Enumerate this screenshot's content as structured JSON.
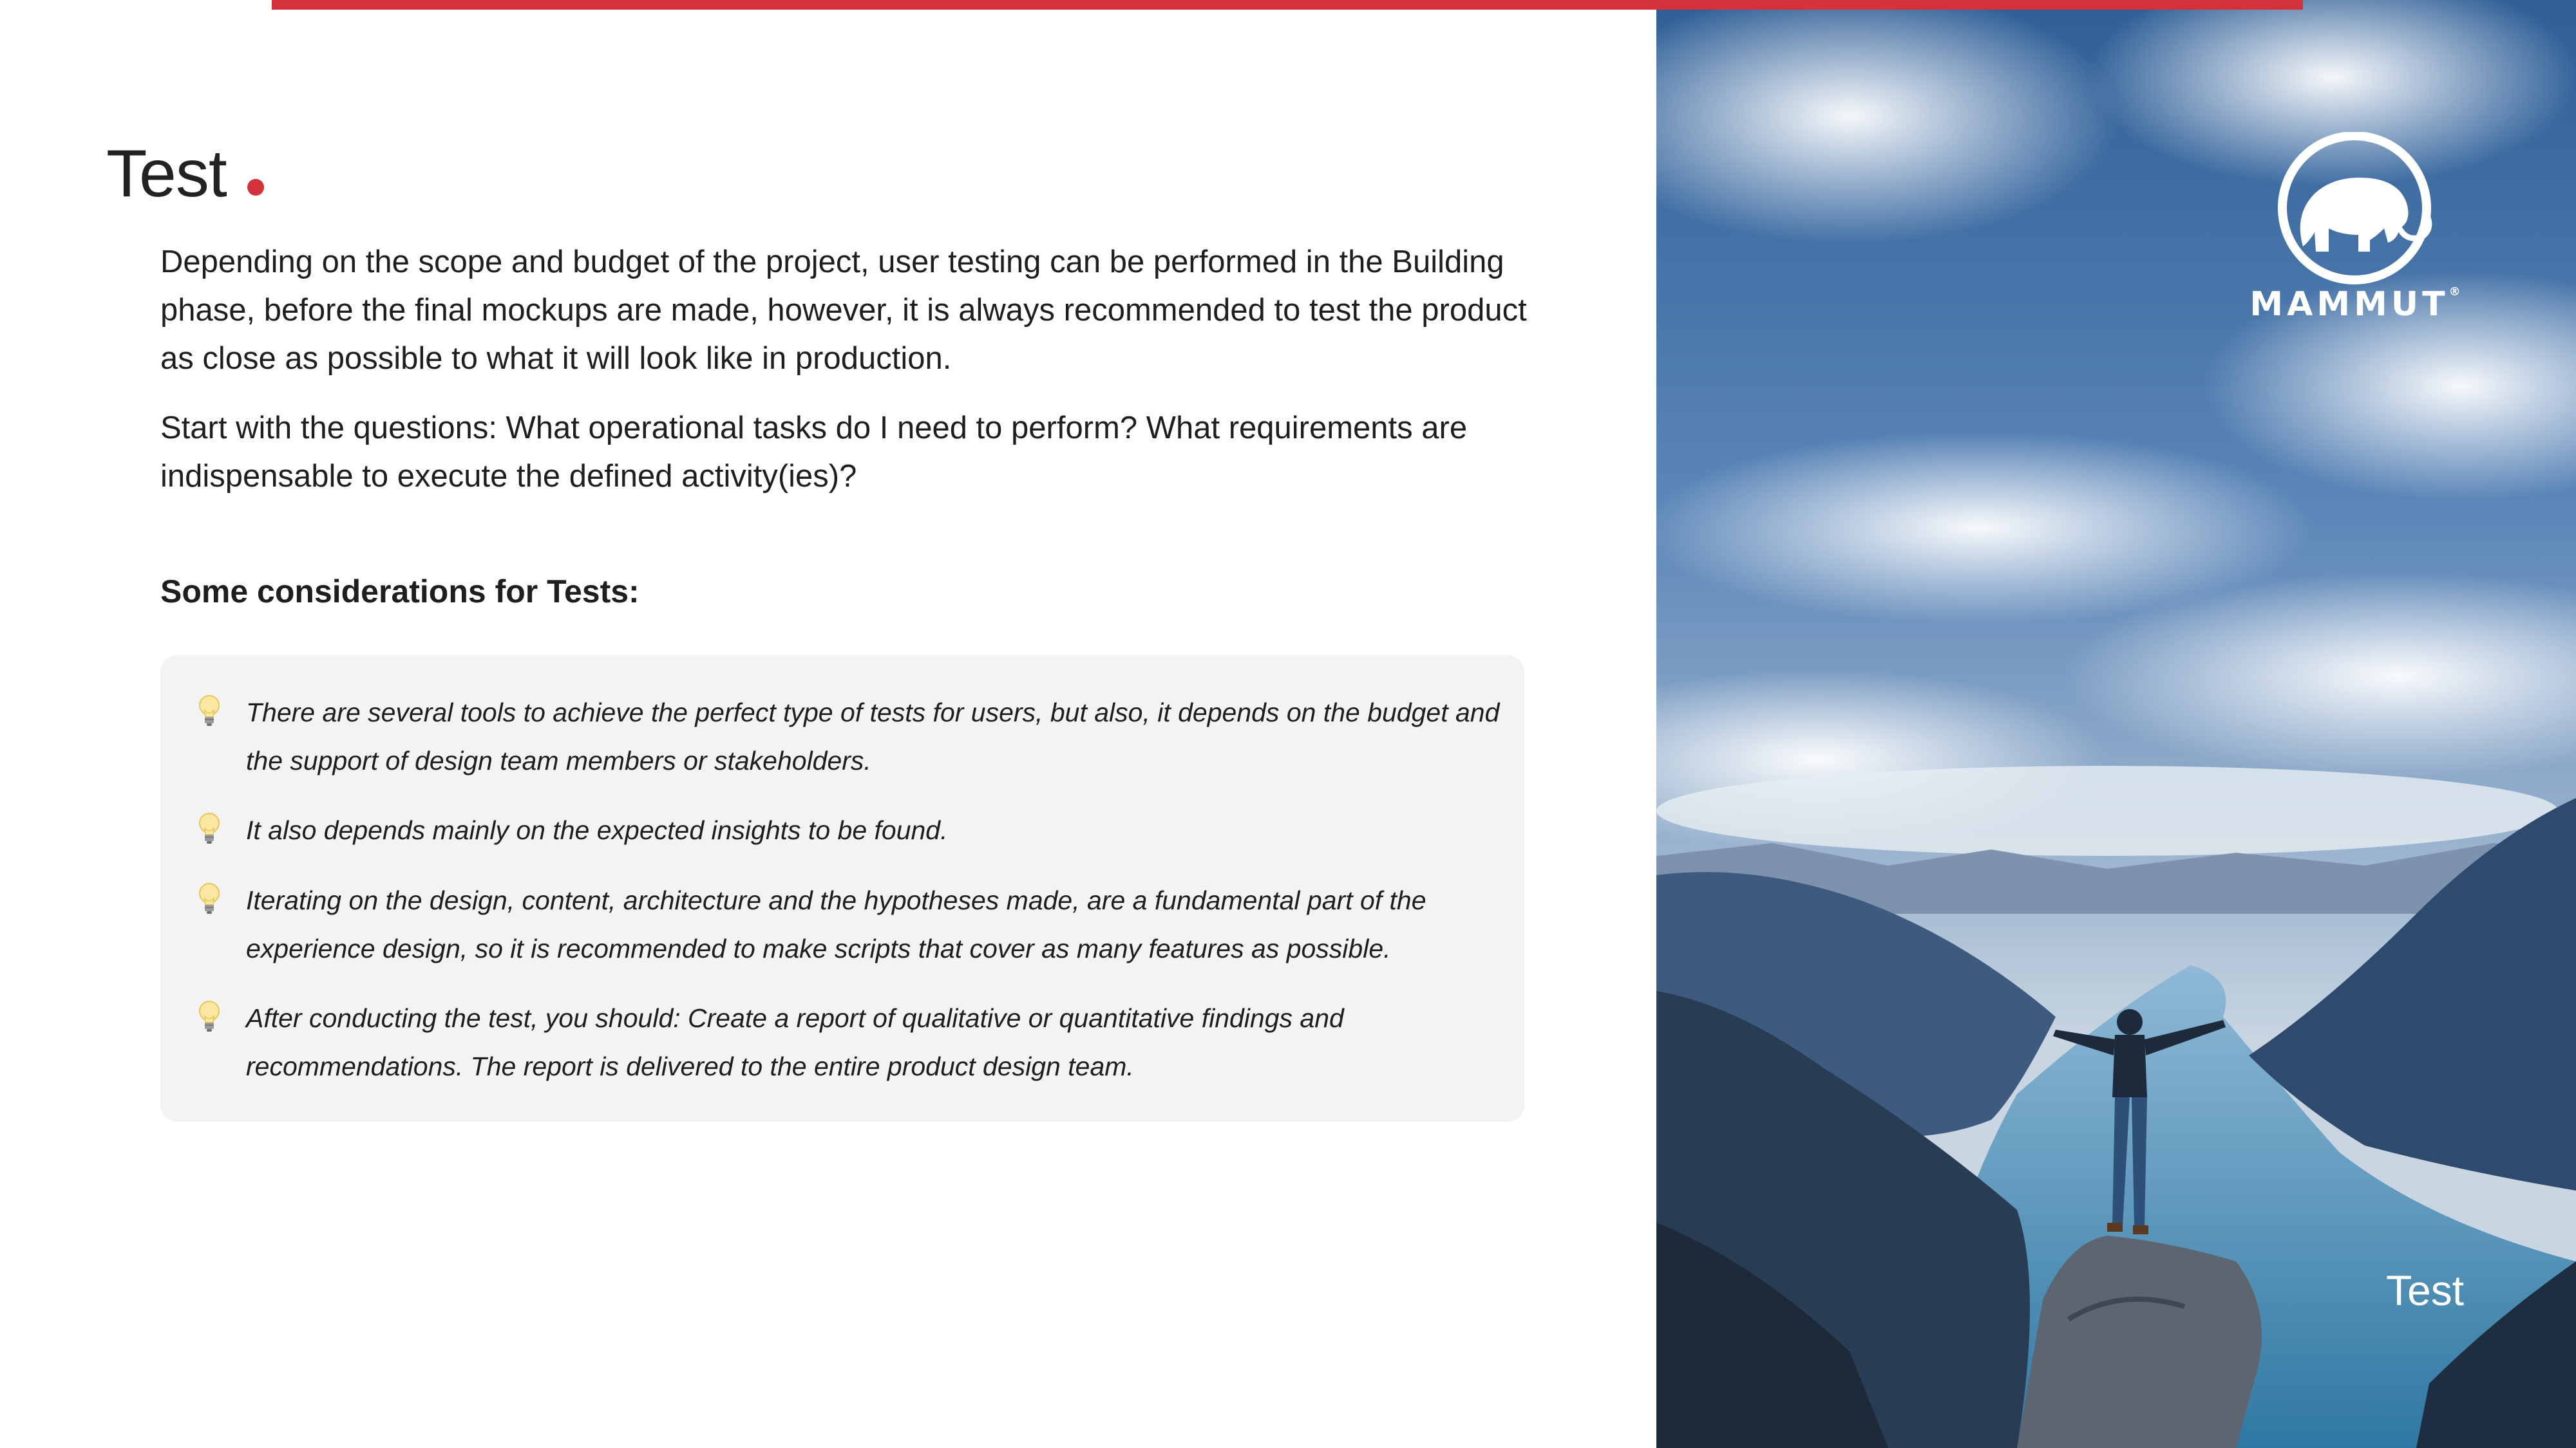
{
  "slide": {
    "title": "Test",
    "paragraphs": [
      "Depending on the scope and budget of the project, user testing can be performed in the Building phase, before the final mockups are made, however, it is always recommended to test the product as close as possible to what it will look like in production.",
      "Start with the questions: What operational tasks do I need to perform? What requirements are indispensable to execute the defined activity(ies)?"
    ],
    "subheading": "Some considerations for Tests:",
    "tips": [
      "There are several tools to achieve the perfect type of tests for users, but also, it depends on the budget and the support of design team members or stakeholders.",
      "It also depends mainly on the expected insights to be found.",
      "Iterating on the design, content, architecture and the hypotheses made, are a fundamental part of the experience design, so it is recommended to make scripts that cover as many features as possible.",
      "After conducting the test, you should: Create a report of qualitative or quantitative findings and recommendations. The report is delivered to the entire product design team."
    ],
    "tip_icon": "lightbulb-icon"
  },
  "photo_panel": {
    "brand": "MAMMUT",
    "brand_mark": "®",
    "caption": "Test"
  },
  "colors": {
    "accent": "#d3323a",
    "card_background": "#f3f3f3",
    "text": "#1e1e1e"
  }
}
